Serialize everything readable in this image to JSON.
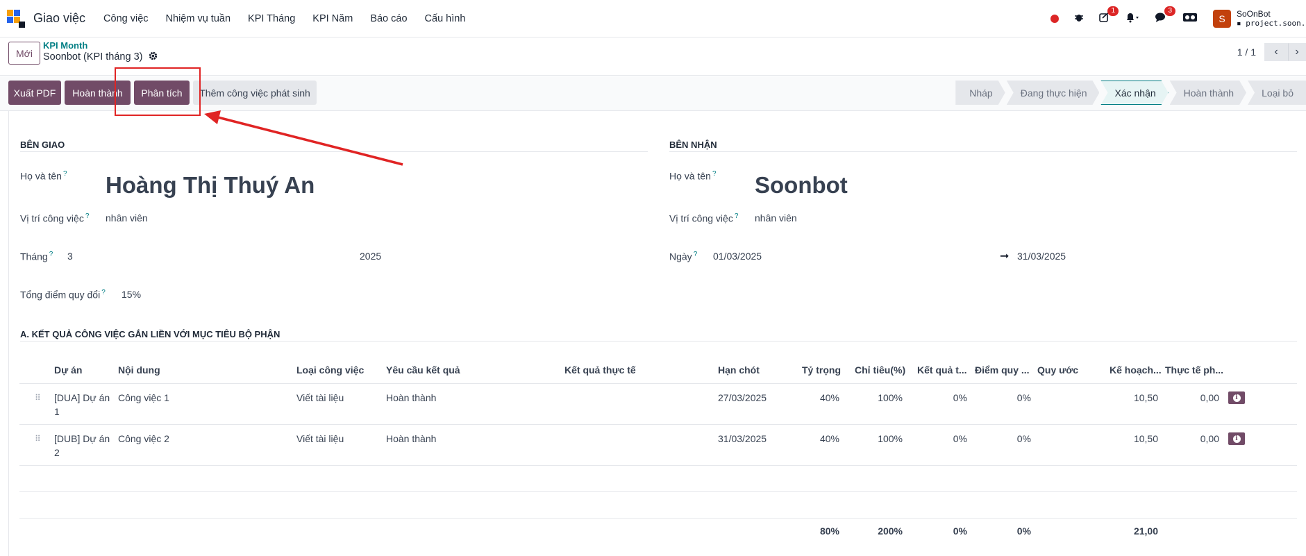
{
  "nav": {
    "app_name": "Giao việc",
    "menu": [
      "Công việc",
      "Nhiệm vụ tuần",
      "KPI Tháng",
      "KPI Năm",
      "Báo cáo",
      "Cấu hình"
    ],
    "activity_count": "1",
    "message_count": "3",
    "avatar_letter": "S",
    "user_name": "SoOnBot",
    "database": "project.soon."
  },
  "control": {
    "new_label": "Mới",
    "breadcrumb": "KPI Month",
    "record_title": "Soonbot (KPI tháng 3)",
    "pager": "1 / 1"
  },
  "statusbar": {
    "buttons": [
      "Xuất PDF",
      "Hoàn thành",
      "Phân tích",
      "Thêm công việc phát sinh"
    ],
    "stages": [
      "Nháp",
      "Đang thực hiện",
      "Xác nhận",
      "Hoàn thành",
      "Loại bỏ"
    ],
    "current_stage": "Xác nhận"
  },
  "form": {
    "giver": {
      "title": "BÊN GIAO",
      "name_label": "Họ và tên",
      "name": "Hoàng Thị Thuý An",
      "position_label": "Vị trí công việc",
      "position": "nhân viên",
      "month_label": "Tháng",
      "month": "3",
      "year": "2025",
      "score_label": "Tổng điểm quy đổi",
      "score": "15%"
    },
    "receiver": {
      "title": "BÊN NHẬN",
      "name_label": "Họ và tên",
      "name": "Soonbot",
      "position_label": "Vị trí công việc",
      "position": "nhân viên",
      "date_label": "Ngày",
      "date_from": "01/03/2025",
      "date_to": "31/03/2025"
    },
    "section_a_title": "A. KẾT QUẢ CÔNG VIỆC GẮN LIỀN VỚI MỤC TIÊU BỘ PHẬN"
  },
  "table": {
    "headers": [
      "Dự án",
      "Nội dung",
      "Loại công việc",
      "Yêu cầu kết quả",
      "Kết quả thực tế",
      "Hạn chót",
      "Tỷ trọng",
      "Chỉ tiêu(%)",
      "Kết quả t...",
      "Điểm quy ...",
      "Quy ước",
      "Kế hoạch...",
      "Thực tế ph..."
    ],
    "rows": [
      {
        "project_1": "[DUA] Dự án",
        "project_2": "1",
        "content": "Công việc 1",
        "type": "Viết tài liệu",
        "requirement": "Hoàn thành",
        "actual": "",
        "deadline": "27/03/2025",
        "weight": "40%",
        "target": "100%",
        "result": "0%",
        "score": "0%",
        "convention": "",
        "plan": "10,50",
        "actual_hours": "0,00"
      },
      {
        "project_1": "[DUB] Dự án",
        "project_2": "2",
        "content": "Công việc 2",
        "type": "Viết tài liệu",
        "requirement": "Hoàn thành",
        "actual": "",
        "deadline": "31/03/2025",
        "weight": "40%",
        "target": "100%",
        "result": "0%",
        "score": "0%",
        "convention": "",
        "plan": "10,50",
        "actual_hours": "0,00"
      }
    ],
    "totals": {
      "weight": "80%",
      "target": "200%",
      "result": "0%",
      "score": "0%",
      "plan": "21,00"
    }
  },
  "colors": {
    "primary": "#714B67",
    "accent": "#017e84",
    "annotation": "#e02424"
  },
  "icons": [
    "app-logo-icon",
    "record-dot-icon",
    "bug-icon",
    "activity-icon",
    "bell-icon",
    "chat-icon",
    "camera-icon",
    "gear-icon",
    "chevron-left-icon",
    "chevron-right-icon",
    "arrow-right-icon",
    "drag-handle-icon",
    "info-icon"
  ]
}
